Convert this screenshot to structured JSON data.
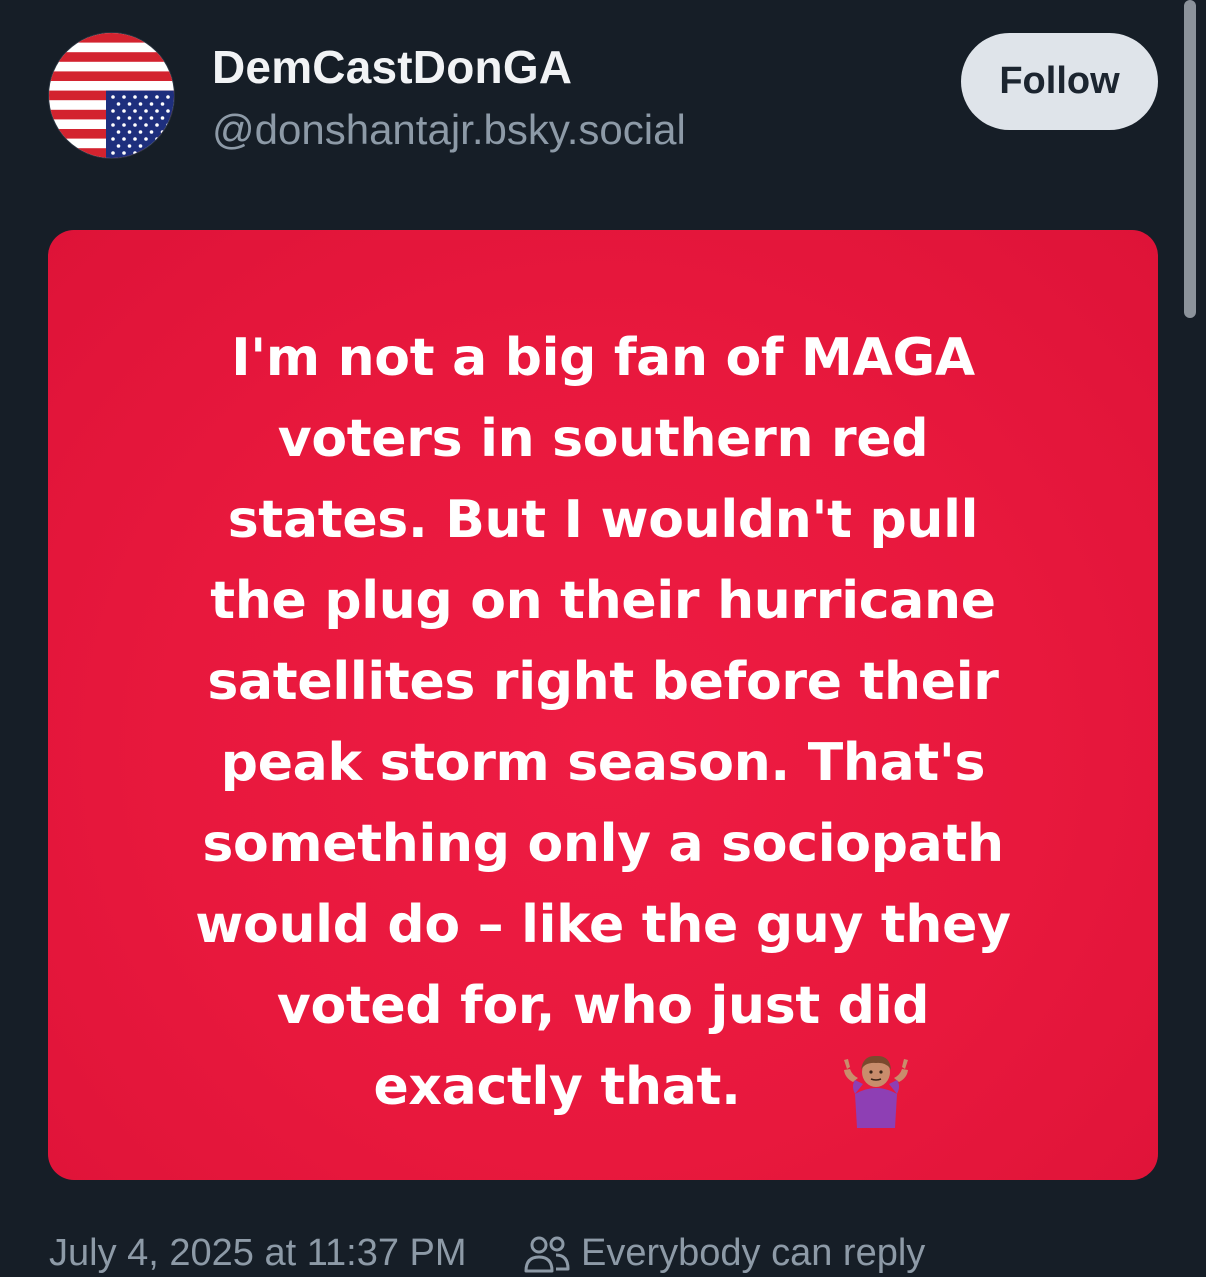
{
  "author": {
    "display_name": "DemCastDonGA",
    "handle": "@donshantajr.bsky.social",
    "avatar_icon": "upside-down-us-flag-icon"
  },
  "follow_button": {
    "label": "Follow"
  },
  "post_image": {
    "background_color": "#e8183d",
    "text_color": "#ffffff",
    "lines": [
      "I'm not a big fan of MAGA",
      "voters in southern red",
      "states. But I wouldn't pull",
      "the plug on their hurricane",
      "satellites right before their",
      "peak storm season. That's",
      "something only a sociopath",
      "would do – like the guy they",
      "voted for, who just did",
      "exactly that."
    ],
    "emoji_icon": "person-shrugging-icon"
  },
  "footer": {
    "timestamp": "July 4, 2025 at 11:37 PM",
    "reply_icon": "people-icon",
    "reply_setting": "Everybody can reply"
  },
  "colors": {
    "background": "#161e27",
    "primary_text": "#f1f3f5",
    "secondary_text": "#8d9aa7",
    "button_bg": "#dfe4ea"
  }
}
